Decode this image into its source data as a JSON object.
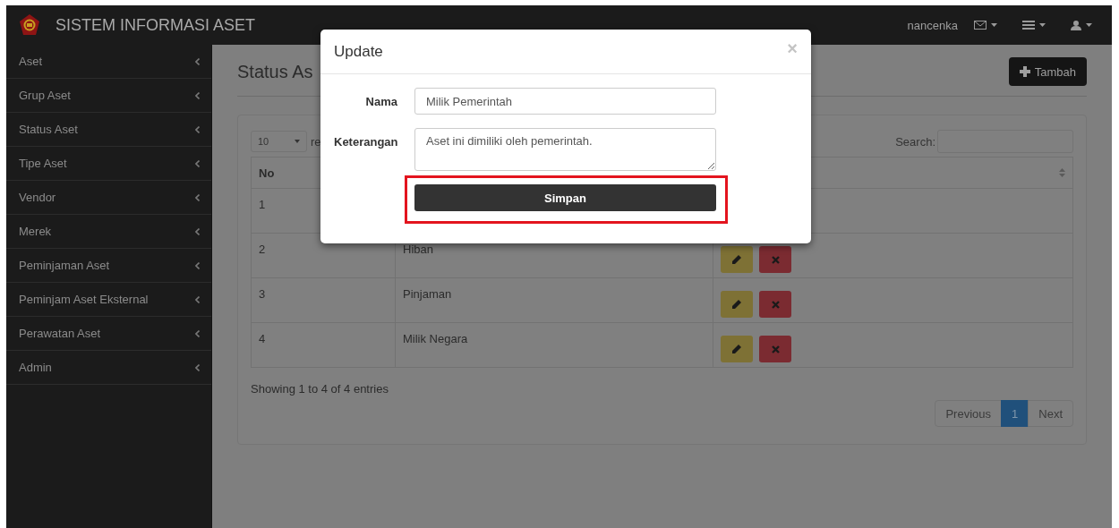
{
  "navbar": {
    "title": "SISTEM INFORMASI ASET",
    "user": "nancenka"
  },
  "sidebar": {
    "items": [
      {
        "label": "Aset"
      },
      {
        "label": "Grup Aset"
      },
      {
        "label": "Status Aset"
      },
      {
        "label": "Tipe Aset"
      },
      {
        "label": "Vendor"
      },
      {
        "label": "Merek"
      },
      {
        "label": "Peminjaman Aset"
      },
      {
        "label": "Peminjam Aset Eksternal"
      },
      {
        "label": "Perawatan Aset"
      },
      {
        "label": "Admin"
      }
    ]
  },
  "page": {
    "title": "Status As",
    "add_button": "Tambah"
  },
  "table_controls": {
    "length": "10",
    "length_suffix": "re",
    "search_label": "Search:"
  },
  "table": {
    "columns": [
      "No"
    ],
    "rows": [
      {
        "no": "1"
      },
      {
        "no": "2",
        "name": "Hiban"
      },
      {
        "no": "3",
        "name": "Pinjaman"
      },
      {
        "no": "4",
        "name": "Milik Negara"
      }
    ]
  },
  "table_info": "Showing 1 to 4 of 4 entries",
  "pagination": [
    {
      "label": "Previous",
      "selected": false
    },
    {
      "label": "1",
      "selected": true
    },
    {
      "label": "Next",
      "selected": false
    }
  ],
  "modal": {
    "title": "Update",
    "close": "×",
    "fields": [
      {
        "label": "Nama",
        "value": "Milik Pemerintah",
        "kind": "input"
      },
      {
        "label": "Keterangan",
        "value": "Aset ini dimiliki oleh pemerintah.",
        "kind": "textarea"
      }
    ],
    "submit": "Simpan",
    "highlighted": true
  }
}
